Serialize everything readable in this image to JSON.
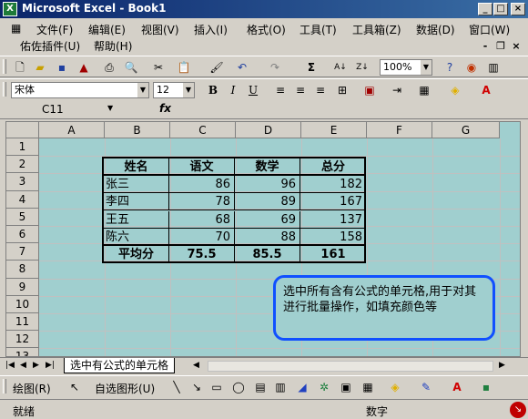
{
  "window": {
    "title": "Microsoft Excel - Book1"
  },
  "menu": {
    "items": [
      "文件(F)",
      "编辑(E)",
      "视图(V)",
      "插入(I)",
      "格式(O)",
      "工具(T)",
      "工具箱(Z)",
      "数据(D)",
      "窗口(W)",
      "佑佐插件(U)",
      "帮助(H)"
    ]
  },
  "toolbar": {
    "zoom": "100%",
    "font_name": "宋体",
    "font_size": "12"
  },
  "formula_bar": {
    "name_box": "C11",
    "fx_label": "fx",
    "formula": ""
  },
  "sheet": {
    "columns": [
      "A",
      "B",
      "C",
      "D",
      "E",
      "F",
      "G"
    ],
    "rows": [
      "1",
      "2",
      "3",
      "4",
      "5",
      "6",
      "7",
      "8",
      "9",
      "10",
      "11",
      "12",
      "13"
    ],
    "table": {
      "headers": [
        "姓名",
        "语文",
        "数学",
        "总分"
      ],
      "rows": [
        [
          "张三",
          "86",
          "96",
          "182"
        ],
        [
          "李四",
          "78",
          "89",
          "167"
        ],
        [
          "王五",
          "68",
          "69",
          "137"
        ],
        [
          "陈六",
          "70",
          "88",
          "158"
        ]
      ],
      "summary": [
        "平均分",
        "75.5",
        "85.5",
        "161"
      ]
    },
    "callout": "选中所有含有公式的单元格,用于对其进行批量操作，如填充颜色等",
    "tab": "选中有公式的单元格"
  },
  "drawing_toolbar": {
    "draw_label": "绘图(R)",
    "autoshape_label": "自选图形(U)"
  },
  "status": {
    "left": "就绪",
    "right": "数字"
  },
  "colors": {
    "sheet_bg": "#a0cfcf",
    "callout_border": "#1050ff",
    "title_start": "#0a246a"
  }
}
